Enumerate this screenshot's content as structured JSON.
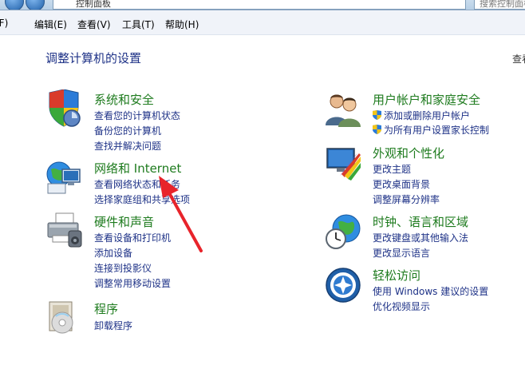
{
  "addressbar": {
    "path": "控制面板",
    "search_placeholder": "搜索控制面板"
  },
  "menu": {
    "file": "(F)",
    "edit": "编辑(E)",
    "view": "查看(V)",
    "tools": "工具(T)",
    "help": "帮助(H)"
  },
  "page": {
    "title": "调整计算机的设置",
    "view_by": "查看"
  },
  "left_categories": [
    {
      "title": "系统和安全",
      "links": [
        "查看您的计算机状态",
        "备份您的计算机",
        "查找并解决问题"
      ]
    },
    {
      "title": "网络和 Internet",
      "links": [
        "查看网络状态和任务",
        "选择家庭组和共享选项"
      ]
    },
    {
      "title": "硬件和声音",
      "links": [
        "查看设备和打印机",
        "添加设备",
        "连接到投影仪",
        "调整常用移动设置"
      ]
    },
    {
      "title": "程序",
      "links": [
        "卸载程序"
      ]
    }
  ],
  "right_categories": [
    {
      "title": "用户帐户和家庭安全",
      "links": [
        "添加或删除用户帐户",
        "为所有用户设置家长控制"
      ]
    },
    {
      "title": "外观和个性化",
      "links": [
        "更改主题",
        "更改桌面背景",
        "调整屏幕分辨率"
      ]
    },
    {
      "title": "时钟、语言和区域",
      "links": [
        "更改键盘或其他输入法",
        "更改显示语言"
      ]
    },
    {
      "title": "轻松访问",
      "links": [
        "使用 Windows 建议的设置",
        "优化视频显示"
      ]
    }
  ],
  "colors": {
    "title_green": "#1e7b1e",
    "link_blue": "#1e3287",
    "arrow_red": "#e8242b"
  }
}
